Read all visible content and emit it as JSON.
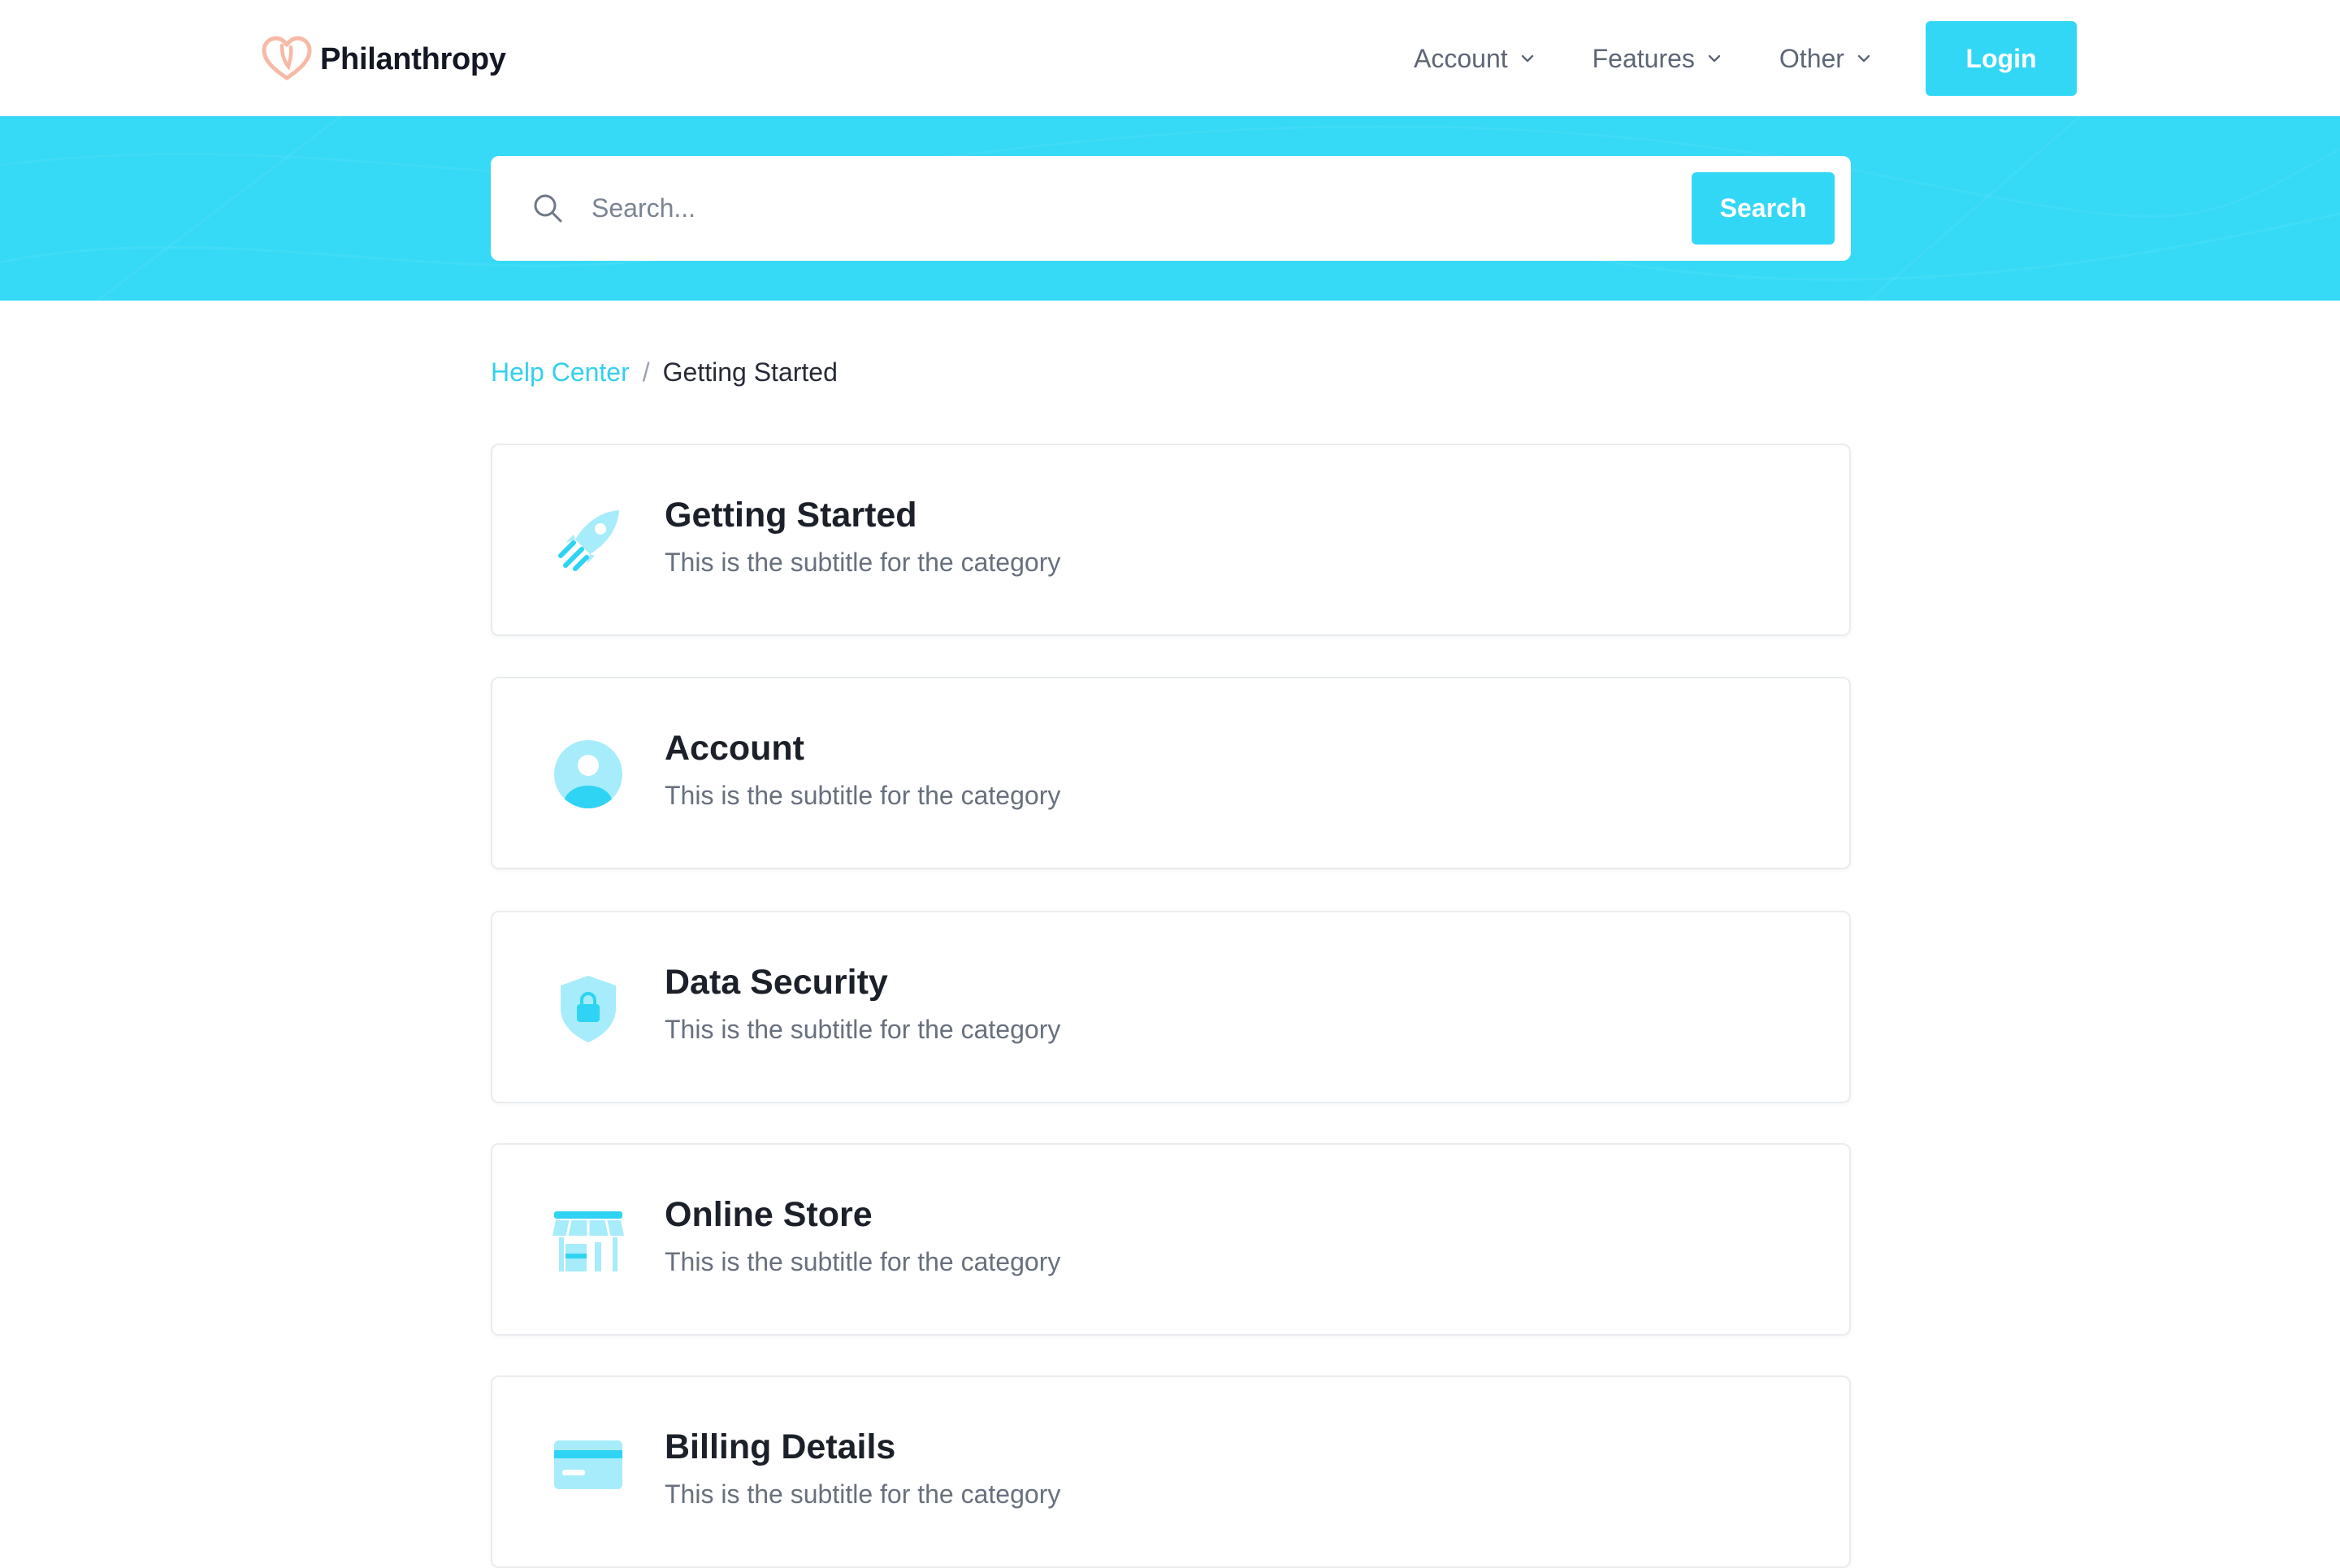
{
  "brand": {
    "name": "Philanthropy"
  },
  "nav": {
    "items": [
      {
        "label": "Account"
      },
      {
        "label": "Features"
      },
      {
        "label": "Other"
      }
    ],
    "login_label": "Login"
  },
  "search": {
    "placeholder": "Search...",
    "button_label": "Search"
  },
  "breadcrumb": {
    "root": "Help Center",
    "separator": "/",
    "current": "Getting Started"
  },
  "categories": [
    {
      "icon": "rocket-icon",
      "title": "Getting Started",
      "subtitle": "This is the subtitle for the category"
    },
    {
      "icon": "user-icon",
      "title": "Account",
      "subtitle": "This is the subtitle for the category"
    },
    {
      "icon": "shield-lock-icon",
      "title": "Data Security",
      "subtitle": "This is the subtitle for the category"
    },
    {
      "icon": "store-icon",
      "title": "Online Store",
      "subtitle": "This is the subtitle for the category"
    },
    {
      "icon": "billing-icon",
      "title": "Billing Details",
      "subtitle": "This is the subtitle for the category"
    }
  ],
  "colors": {
    "accent": "#33d7f6",
    "hero_background": "#36daf6",
    "link": "#33d0ee",
    "icon_light": "#a6ecfa",
    "icon_dark": "#2fd3f3",
    "brand_icon": "#f7b9a6"
  }
}
